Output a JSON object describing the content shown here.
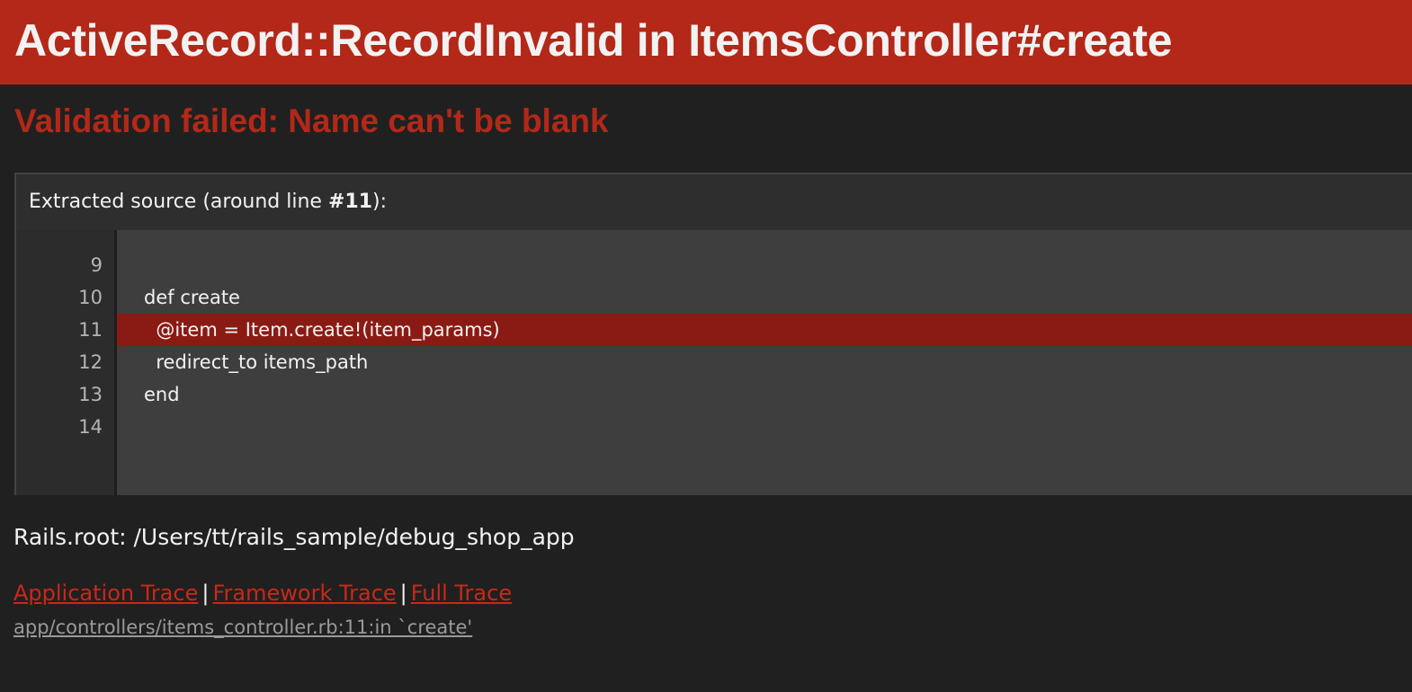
{
  "header": {
    "title": "ActiveRecord::RecordInvalid in ItemsController#create"
  },
  "error": {
    "message": "Validation failed: Name can't be blank"
  },
  "source": {
    "header_prefix": "Extracted source (around line ",
    "header_line": "#11",
    "header_suffix": "):",
    "highlighted_line": 11,
    "lines": [
      {
        "number": "9",
        "code": ""
      },
      {
        "number": "10",
        "code": "def create"
      },
      {
        "number": "11",
        "code": "  @item = Item.create!(item_params)"
      },
      {
        "number": "12",
        "code": "  redirect_to items_path"
      },
      {
        "number": "13",
        "code": "end"
      },
      {
        "number": "14",
        "code": ""
      }
    ]
  },
  "rails_root": "Rails.root: /Users/tt/rails_sample/debug_shop_app",
  "trace": {
    "links": [
      "Application Trace",
      "Framework Trace",
      "Full Trace"
    ],
    "separator": "|",
    "entries": [
      "app/controllers/items_controller.rb:11:in `create'"
    ]
  },
  "colors": {
    "header_bg": "#b32818",
    "page_bg": "#202020",
    "error_text": "#b32818",
    "highlight_line": "#8a1b14",
    "link": "#c7291a"
  }
}
